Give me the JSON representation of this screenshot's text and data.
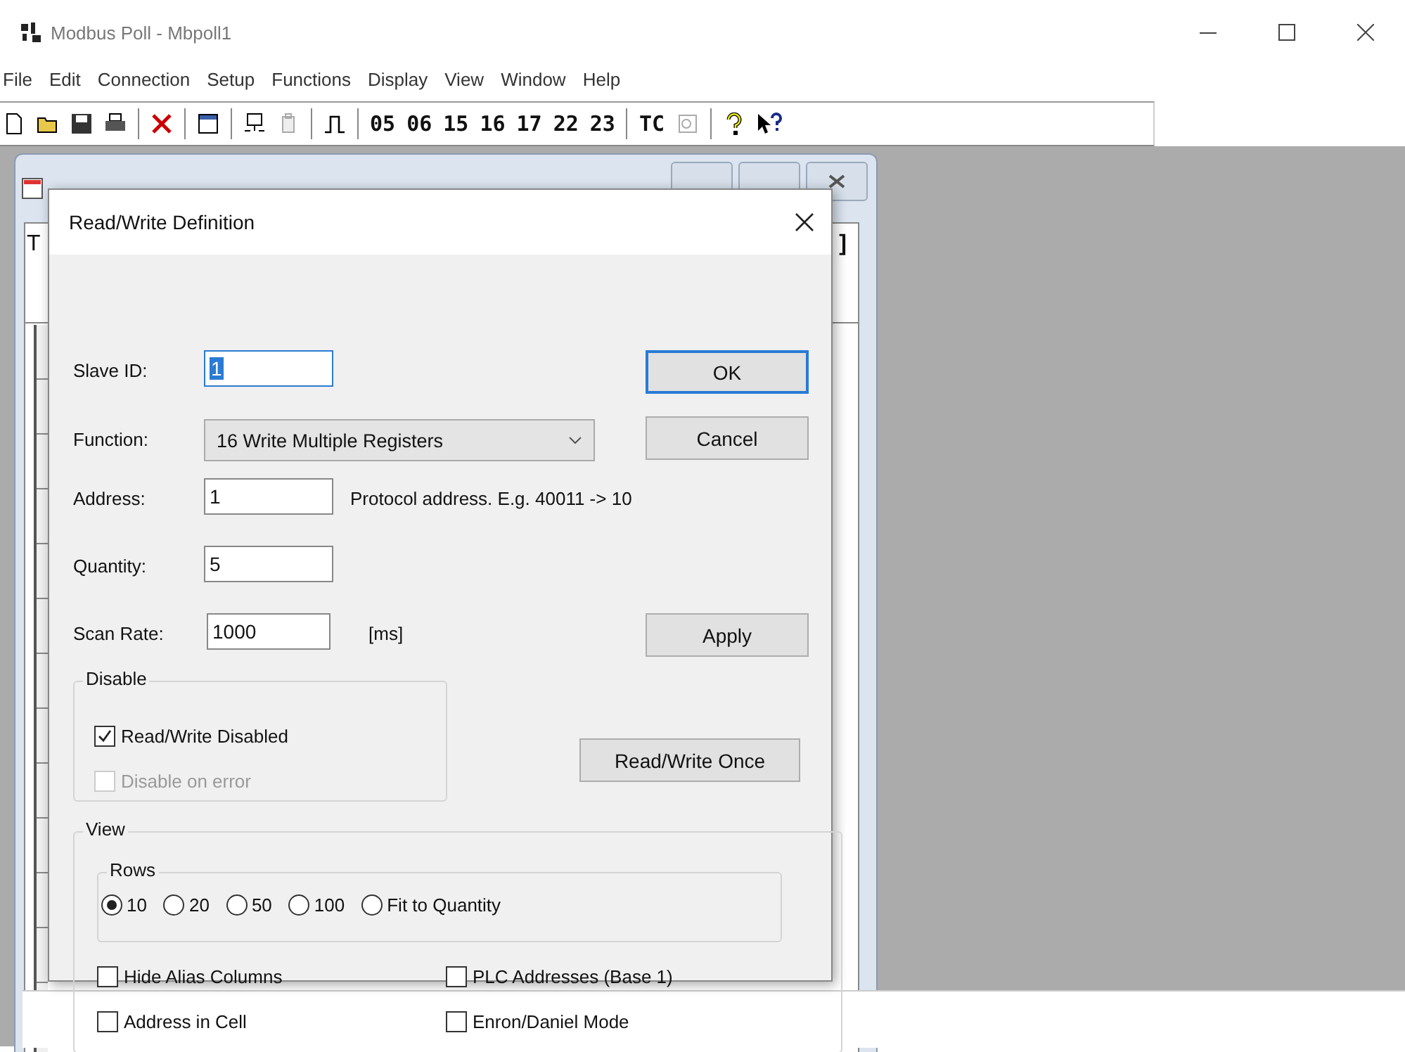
{
  "window": {
    "title": "Modbus Poll - Mbpoll1"
  },
  "menu": [
    "File",
    "Edit",
    "Connection",
    "Setup",
    "Functions",
    "Display",
    "View",
    "Window",
    "Help"
  ],
  "toolbar": {
    "function_codes": [
      "05",
      "06",
      "15",
      "16",
      "17",
      "22",
      "23"
    ],
    "tc_label": "TC"
  },
  "child_window": {
    "header_left": "T",
    "header_right": "]"
  },
  "dialog": {
    "title": "Read/Write Definition",
    "slave_id": {
      "label": "Slave ID:",
      "value": "1"
    },
    "function": {
      "label": "Function:",
      "value": "16 Write Multiple Registers"
    },
    "address": {
      "label": "Address:",
      "value": "1",
      "hint": "Protocol address. E.g. 40011 -> 10"
    },
    "quantity": {
      "label": "Quantity:",
      "value": "5"
    },
    "scan_rate": {
      "label": "Scan Rate:",
      "value": "1000",
      "unit": "[ms]"
    },
    "buttons": {
      "ok": "OK",
      "cancel": "Cancel",
      "apply": "Apply",
      "once": "Read/Write Once"
    },
    "disable_group": {
      "title": "Disable",
      "options": [
        {
          "label": "Read/Write Disabled",
          "checked": true,
          "disabled": false
        },
        {
          "label": "Disable on error",
          "checked": false,
          "disabled": true
        }
      ]
    },
    "view_group": {
      "title": "View",
      "rows_title": "Rows",
      "rows": [
        {
          "label": "10",
          "selected": true
        },
        {
          "label": "20",
          "selected": false
        },
        {
          "label": "50",
          "selected": false
        },
        {
          "label": "100",
          "selected": false
        },
        {
          "label": "Fit to Quantity",
          "selected": false
        }
      ],
      "options": [
        {
          "label": "Hide Alias Columns",
          "checked": false
        },
        {
          "label": "PLC Addresses (Base 1)",
          "checked": false
        },
        {
          "label": "Address in Cell",
          "checked": false
        },
        {
          "label": "Enron/Daniel Mode",
          "checked": false
        }
      ]
    }
  }
}
